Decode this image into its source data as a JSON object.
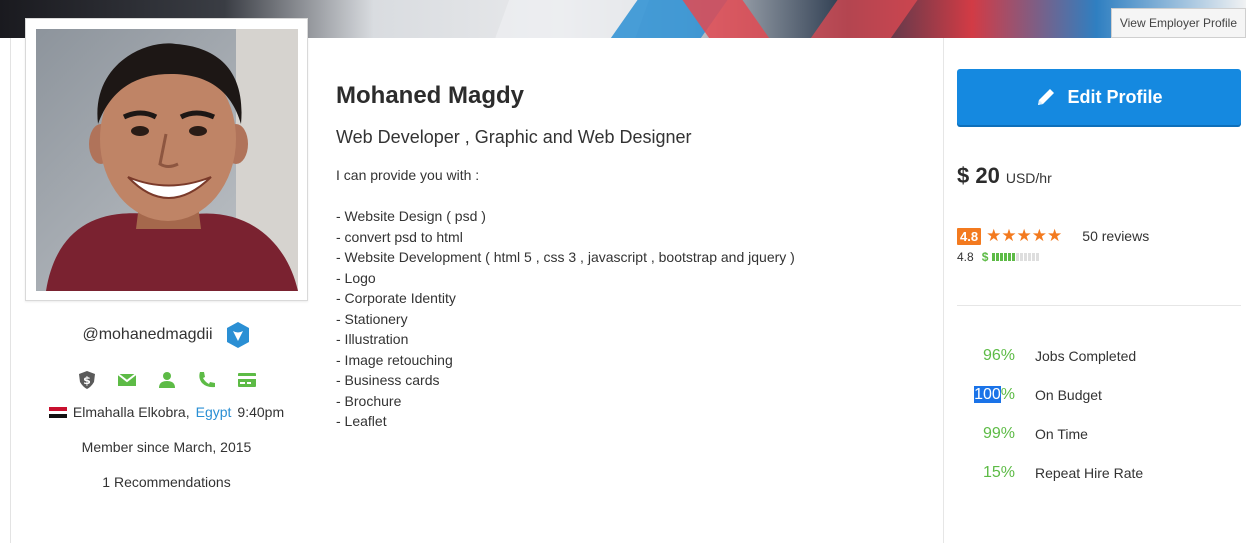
{
  "header": {
    "employer_button": "View Employer Profile"
  },
  "profile": {
    "username": "@mohanedmagdii",
    "location_city": "Elmahalla Elkobra,",
    "location_country": "Egypt",
    "local_time": "9:40pm",
    "member_since": "Member since March, 2015",
    "recommendations": "1 Recommendations",
    "name": "Mohaned Magdy",
    "tagline": "Web Developer , Graphic and Web Designer",
    "bio_intro": "I can provide you with :",
    "bio_items": [
      "- Website Design ( psd )",
      "- convert psd to html",
      "- Website Development ( html 5 , css 3 , javascript , bootstrap and jquery )",
      "- Logo",
      "- Corporate Identity",
      "- Stationery",
      "- Illustration",
      "- Image retouching",
      "- Business cards",
      "- Brochure",
      "- Leaflet"
    ],
    "verification_icons": [
      "shield-dollar-icon",
      "email-icon",
      "user-icon",
      "phone-icon",
      "payment-card-icon"
    ]
  },
  "sidebar": {
    "edit_button": "Edit Profile",
    "rate_amount": "$ 20",
    "rate_unit": "USD/hr",
    "rating_value": "4.8",
    "stars": "★★★★★",
    "reviews": "50 reviews",
    "earnings_score": "4.8",
    "earnings_symbol": "$",
    "earnings_level": 0.5,
    "stats": [
      {
        "pct_num": "96",
        "pct_sign": "%",
        "label": "Jobs Completed"
      },
      {
        "pct_num": "100",
        "pct_sign": "%",
        "label": "On Budget"
      },
      {
        "pct_num": "99",
        "pct_sign": "%",
        "label": "On Time"
      },
      {
        "pct_num": "15",
        "pct_sign": "%",
        "label": "Repeat Hire Rate"
      }
    ]
  },
  "colors": {
    "accent_blue": "#1589e0",
    "rating_orange": "#f37a1f",
    "stat_green": "#5dbb46",
    "link_blue": "#2a8fd4"
  }
}
